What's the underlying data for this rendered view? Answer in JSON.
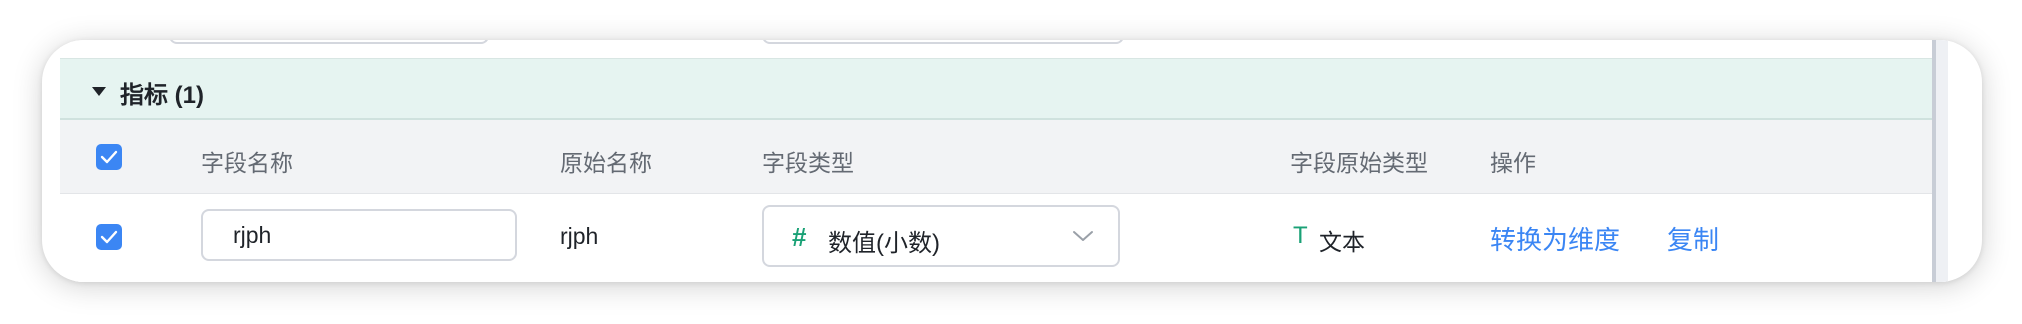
{
  "section": {
    "title": "指标 (1)"
  },
  "table": {
    "columns": [
      "字段名称",
      "原始名称",
      "字段类型",
      "字段原始类型",
      "操作"
    ],
    "rows": [
      {
        "field_name": "rjph",
        "original_name": "rjph",
        "field_type": "数值(小数)",
        "field_type_icon": "hash-icon",
        "original_type": "文本",
        "original_type_icon": "T",
        "actions": [
          "转换为维度",
          "复制"
        ],
        "checked": true
      }
    ],
    "header_checked": true
  },
  "colors": {
    "accent": "#3b86f4",
    "type_icon": "#1aa176",
    "section_bg": "#e6f4f1"
  }
}
